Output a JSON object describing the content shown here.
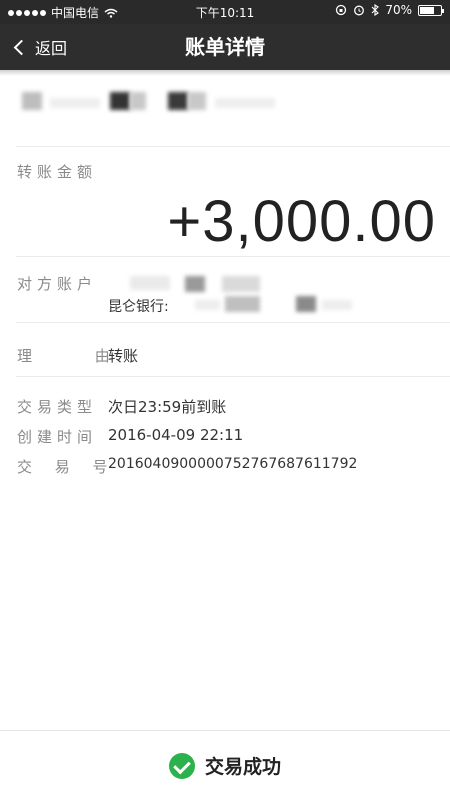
{
  "status_bar": {
    "carrier": "中国电信",
    "time": "下午10:11",
    "battery": "70%",
    "battery_level": 0.7
  },
  "nav": {
    "back_label": "返回",
    "title": "账单详情"
  },
  "details": {
    "amount_label": "转账金额",
    "amount": "+3,000.00",
    "account_label": "对方账户",
    "bank_prefix": "昆仑银行:",
    "reason_label": "理  由",
    "reason_value": "转账",
    "type_label": "交易类型",
    "type_value": "次日23:59前到账",
    "created_label": "创建时间",
    "created_value": "2016-04-09 22:11",
    "txn_label": "交 易 号",
    "txn_value": "20160409000007527676876117​92"
  },
  "footer": {
    "status_text": "交易成功",
    "status_color": "#2bb24c"
  }
}
